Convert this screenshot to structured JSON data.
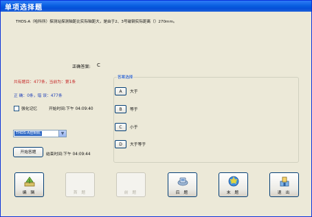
{
  "window": {
    "title": "单项选择题"
  },
  "question": {
    "text": "THDS-A（哈科所）探测站探测轴距比实际轴距大，是由于2、3号磁钢实际距离（）270mm。"
  },
  "answer": {
    "label": "正确答案:",
    "value": "C"
  },
  "stats": {
    "total": "共有题目：477条，当前为：第1条",
    "score": "正    确：0条，错  误：477条"
  },
  "memory": {
    "label": "强化记忆",
    "checked": false
  },
  "times": {
    "start": "开始时间:下午 04:09:40",
    "end": "结束时间:下午 04:09:44"
  },
  "machine_select": {
    "value": "THDS-A控制机"
  },
  "start_button": {
    "label": "开始答题"
  },
  "options_group": {
    "legend": "答案选择",
    "options": [
      {
        "key": "A",
        "text": "大于"
      },
      {
        "key": "B",
        "text": "等于"
      },
      {
        "key": "C",
        "text": "小于"
      },
      {
        "key": "D",
        "text": "大于等于"
      }
    ]
  },
  "toolbar": {
    "buttons": [
      {
        "label": "编 辑",
        "icon": "edit-icon",
        "enabled": true
      },
      {
        "label": "首 题",
        "icon": "first-icon",
        "enabled": false
      },
      {
        "label": "前 题",
        "icon": "prev-icon",
        "enabled": false
      },
      {
        "label": "后 题",
        "icon": "next-icon",
        "enabled": true
      },
      {
        "label": "末 题",
        "icon": "last-icon",
        "enabled": true
      },
      {
        "label": "退 出",
        "icon": "exit-icon",
        "enabled": true
      }
    ]
  },
  "colors": {
    "titlebar": "#0a5fe0",
    "stat_red": "#c62828",
    "stat_blue": "#1e3fb8",
    "legend_blue": "#0046d5"
  }
}
